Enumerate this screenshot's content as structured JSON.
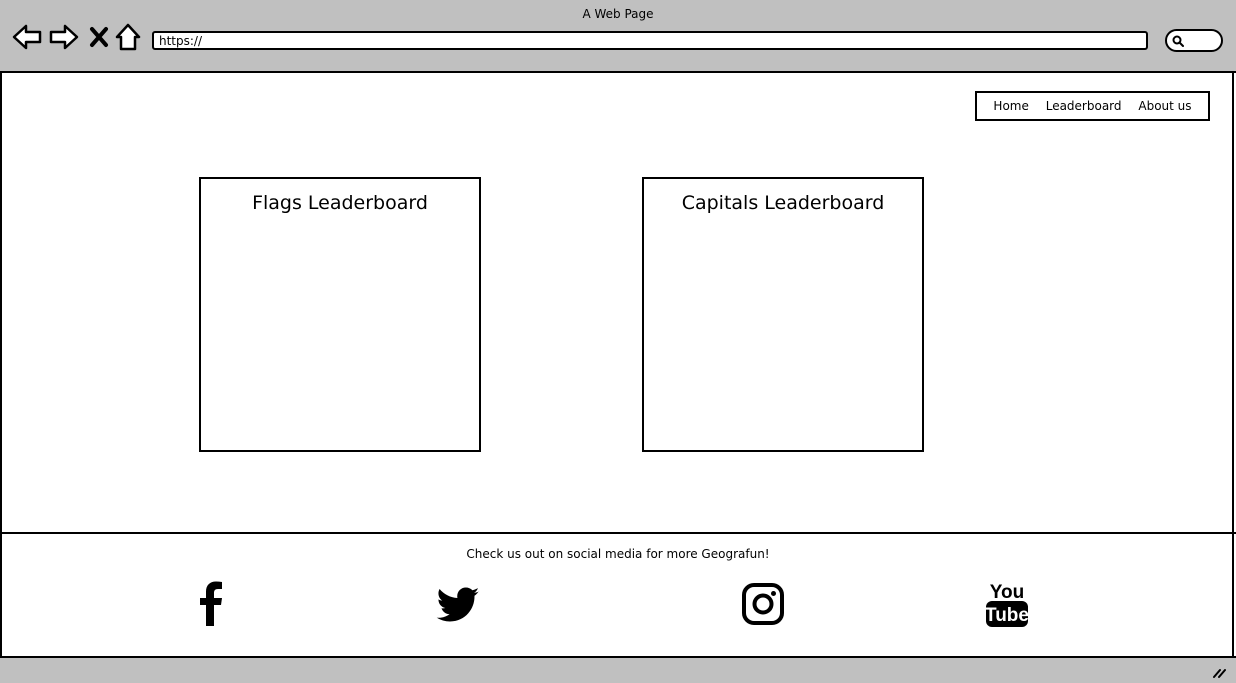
{
  "window": {
    "title": "A Web Page"
  },
  "toolbar": {
    "back_icon": "back-arrow-icon",
    "forward_icon": "forward-arrow-icon",
    "close_icon": "x-icon",
    "home_icon": "home-icon",
    "url": "https://",
    "search_icon": "magnifier-icon"
  },
  "nav": {
    "items": [
      {
        "label": "Home"
      },
      {
        "label": "Leaderboard"
      },
      {
        "label": "About us"
      }
    ]
  },
  "main": {
    "boards": [
      {
        "title": "Flags Leaderboard"
      },
      {
        "title": "Capitals Leaderboard"
      }
    ]
  },
  "footer": {
    "text": "Check us out on social media for more Geografun!",
    "social": [
      {
        "icon": "facebook-icon"
      },
      {
        "icon": "twitter-icon"
      },
      {
        "icon": "instagram-icon"
      },
      {
        "icon": "youtube-icon",
        "label_top": "You",
        "label_bottom": "Tube"
      }
    ]
  },
  "colors": {
    "chrome": "#c0c0c0",
    "ink": "#000000",
    "page": "#ffffff"
  }
}
